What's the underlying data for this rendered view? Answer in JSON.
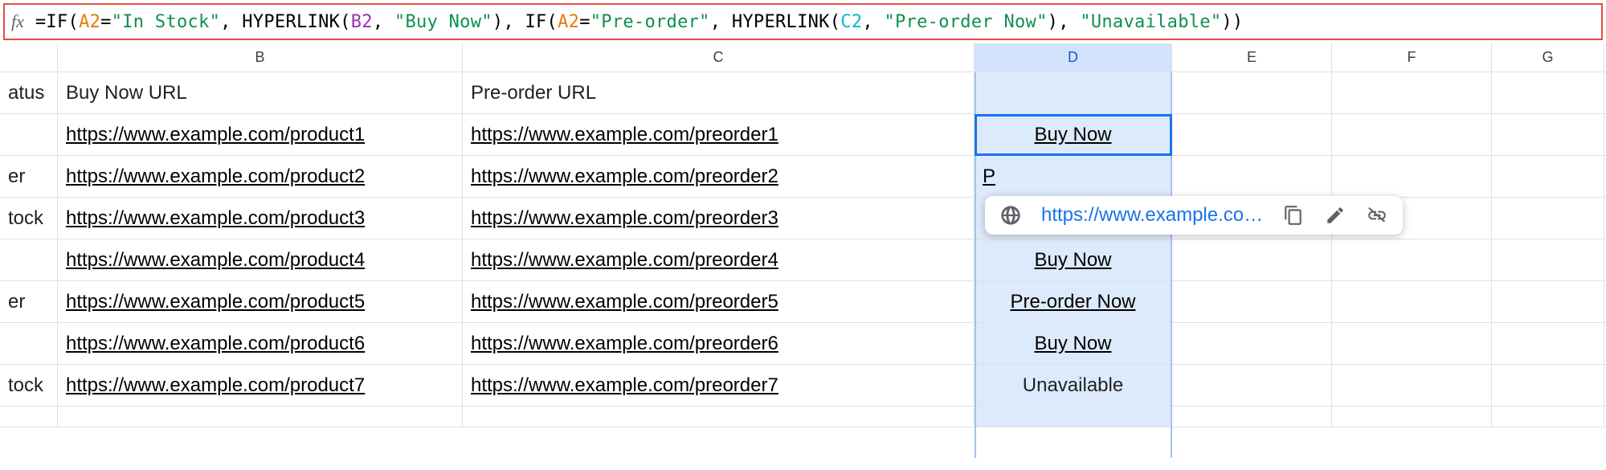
{
  "formula": {
    "raw": "=IF(A2=\"In Stock\", HYPERLINK(B2, \"Buy Now\"), IF(A2=\"Pre-order\", HYPERLINK(C2, \"Pre-order Now\"), \"Unavailable\"))",
    "tokens": [
      {
        "t": "=IF(",
        "c": "tok-fn"
      },
      {
        "t": "A2",
        "c": "tok-ref1"
      },
      {
        "t": "=",
        "c": "tok-punc"
      },
      {
        "t": "\"In Stock\"",
        "c": "tok-str"
      },
      {
        "t": ", HYPERLINK(",
        "c": "tok-fn"
      },
      {
        "t": "B2",
        "c": "tok-ref2"
      },
      {
        "t": ", ",
        "c": "tok-punc"
      },
      {
        "t": "\"Buy Now\"",
        "c": "tok-str"
      },
      {
        "t": "), IF(",
        "c": "tok-fn"
      },
      {
        "t": "A2",
        "c": "tok-ref1"
      },
      {
        "t": "=",
        "c": "tok-punc"
      },
      {
        "t": "\"Pre-order\"",
        "c": "tok-str"
      },
      {
        "t": ", HYPERLINK(",
        "c": "tok-fn"
      },
      {
        "t": "C2",
        "c": "tok-ref3"
      },
      {
        "t": ", ",
        "c": "tok-punc"
      },
      {
        "t": "\"Pre-order Now\"",
        "c": "tok-str"
      },
      {
        "t": "), ",
        "c": "tok-fn"
      },
      {
        "t": "\"Unavailable\"",
        "c": "tok-str"
      },
      {
        "t": "))",
        "c": "tok-fn"
      }
    ]
  },
  "columns": {
    "A": "",
    "B": "B",
    "C": "C",
    "D": "D",
    "E": "E",
    "F": "F",
    "G": "G"
  },
  "active_column": "D",
  "headers": {
    "A": "atus",
    "B": "Buy Now URL",
    "C": "Pre-order URL",
    "D": "",
    "E": "",
    "F": ""
  },
  "rows": [
    {
      "A": "",
      "B": "https://www.example.com/product1",
      "C": "https://www.example.com/preorder1",
      "D": "Buy Now",
      "Dtype": "link"
    },
    {
      "A": "er",
      "B": "https://www.example.com/product2",
      "C": "https://www.example.com/preorder2",
      "D": "P",
      "Dtype": "link-clipped"
    },
    {
      "A": "tock",
      "B": "https://www.example.com/product3",
      "C": "https://www.example.com/preorder3",
      "D": "",
      "Dtype": "blank"
    },
    {
      "A": "",
      "B": "https://www.example.com/product4",
      "C": "https://www.example.com/preorder4",
      "D": "Buy Now",
      "Dtype": "link"
    },
    {
      "A": "er",
      "B": "https://www.example.com/product5",
      "C": "https://www.example.com/preorder5",
      "D": "Pre-order Now",
      "Dtype": "link"
    },
    {
      "A": "",
      "B": "https://www.example.com/product6",
      "C": "https://www.example.com/preorder6",
      "D": "Buy Now",
      "Dtype": "link"
    },
    {
      "A": "tock",
      "B": "https://www.example.com/product7",
      "C": "https://www.example.com/preorder7",
      "D": "Unavailable",
      "Dtype": "plain"
    }
  ],
  "partial_row": {
    "A": "",
    "B": "",
    "C": "",
    "D": "",
    "Dtype": "link"
  },
  "tooltip": {
    "url": "https://www.example.co…"
  }
}
